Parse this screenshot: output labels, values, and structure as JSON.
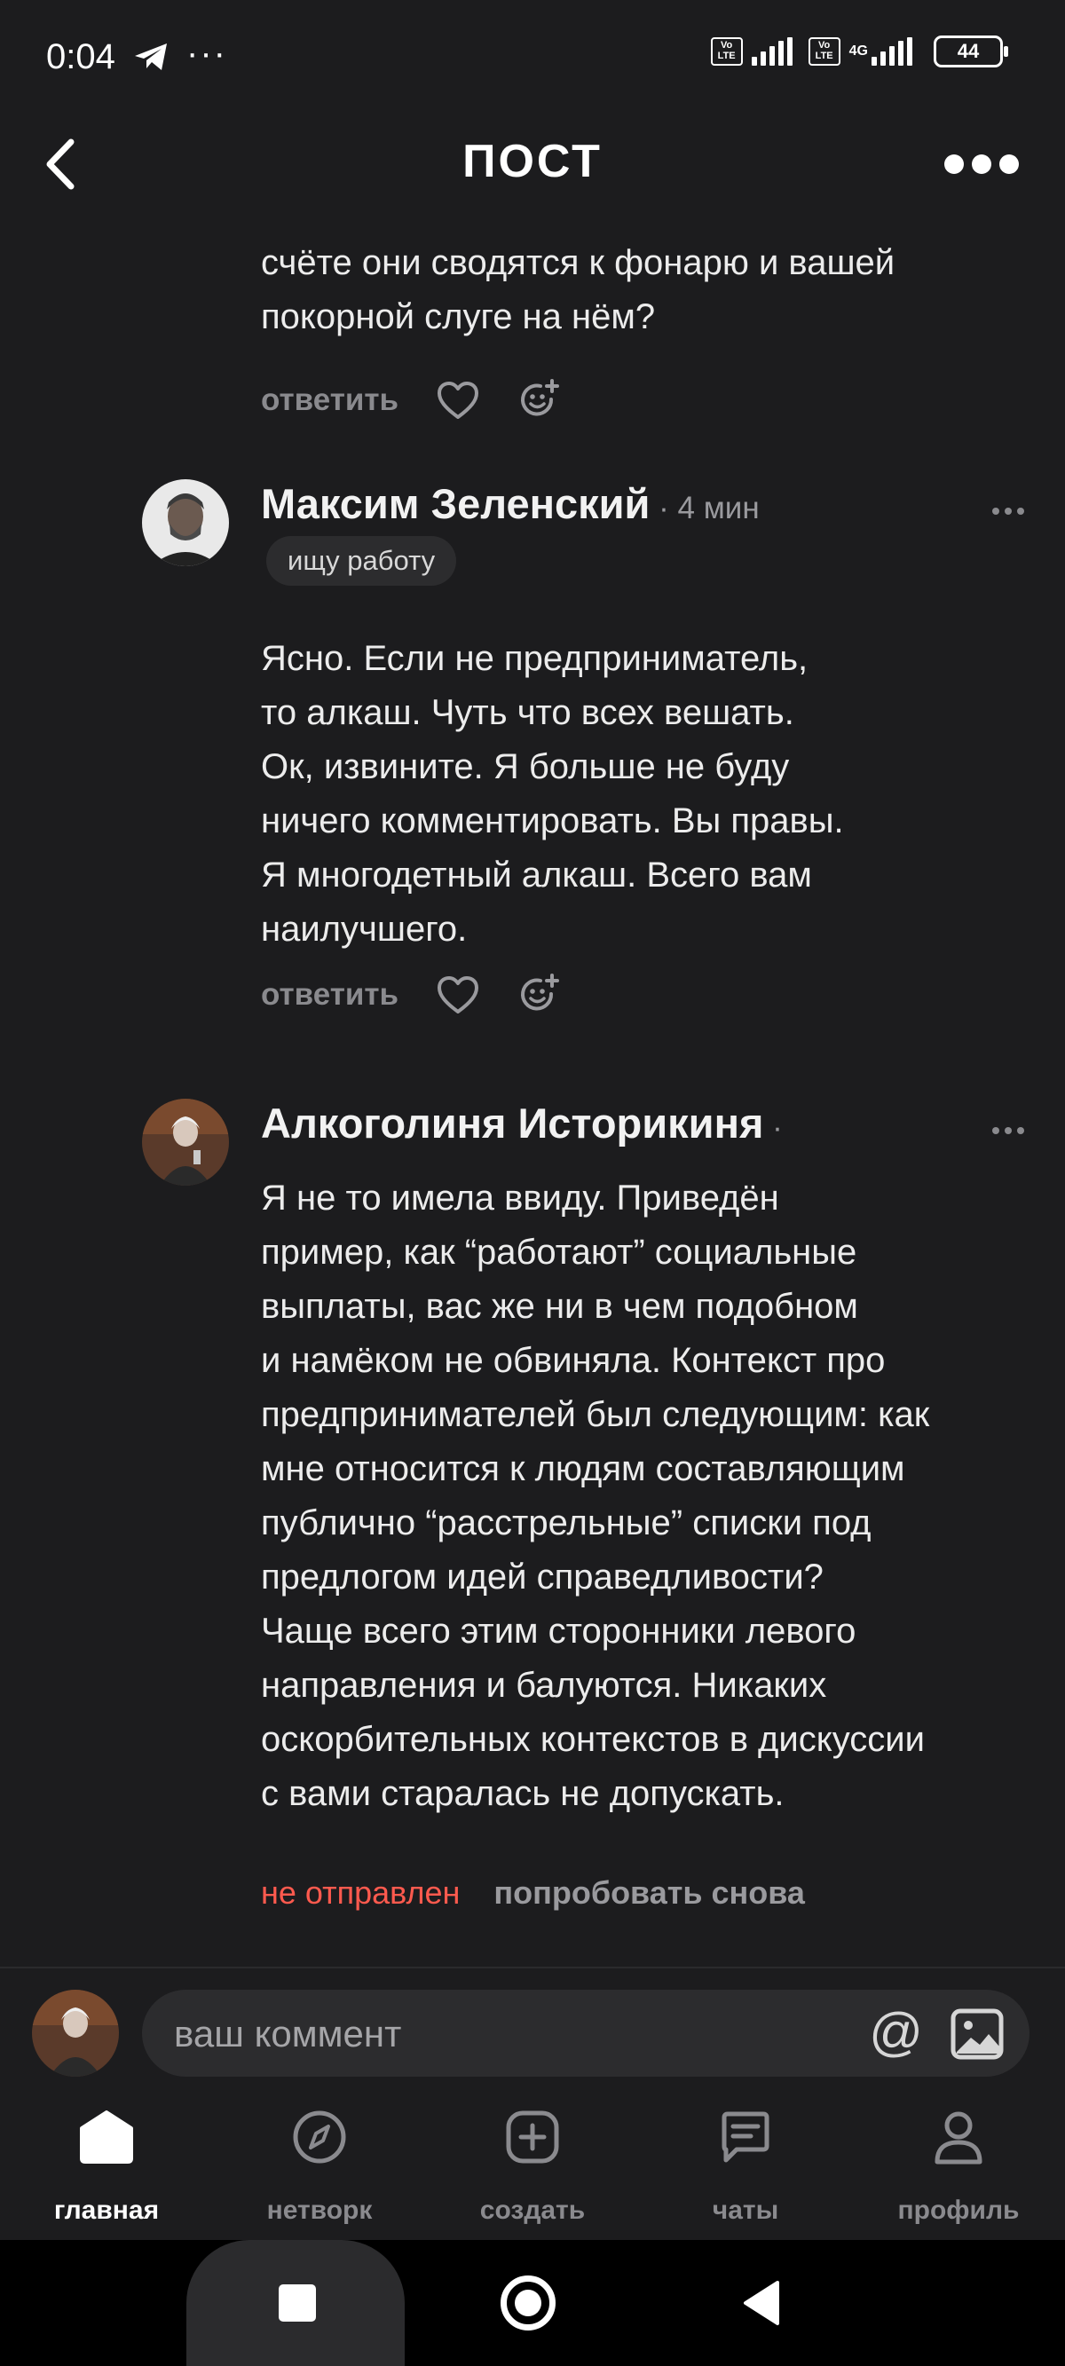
{
  "status_bar": {
    "time": "0:04",
    "dots": "···",
    "volte": "Vo LTE",
    "network": "4G",
    "battery": "44"
  },
  "header": {
    "title": "ПОСТ"
  },
  "feed": {
    "prev_comment": {
      "text_lines": [
        "счёте они сводятся к фонарю и вашей",
        "покорной слуге на нём?"
      ],
      "reply_label": "ответить"
    },
    "comments": [
      {
        "author": "Максим Зеленский",
        "time": " · 4 мин",
        "badge": "ищу работу",
        "text_lines": [
          "Ясно. Если не предприниматель,",
          "то алкаш. Чуть что всех вешать.",
          "Ок, извините. Я больше не буду",
          "ничего комментировать. Вы правы.",
          "Я многодетный алкаш. Всего вам",
          "наилучшего."
        ],
        "reply_label": "ответить"
      },
      {
        "author": "Алкоголиня Историкиня",
        "time": " ·",
        "text_lines": [
          "Я не то имела ввиду. Приведён",
          "пример, как “работают” социальные",
          "выплаты, вас же ни в чем подобном",
          "и намёком не обвиняла. Контекст про",
          "предпринимателей был следующим: как",
          "мне относится к людям составляющим",
          "публично “расстрельные” списки под",
          "предлогом идей справедливости?",
          "Чаще всего этим сторонники левого",
          "направления и балуются. Никаких",
          "оскорбительных контекстов в дискуссии",
          "с вами старалась не допускать."
        ],
        "status": "не отправлен",
        "retry": "попробовать снова"
      }
    ]
  },
  "comment_input": {
    "placeholder": "ваш коммент",
    "at_symbol": "@"
  },
  "bottom_nav": [
    {
      "label": "главная",
      "icon": "home-icon",
      "active": true
    },
    {
      "label": "нетворк",
      "icon": "compass-icon",
      "active": false
    },
    {
      "label": "создать",
      "icon": "plus-square-icon",
      "active": false
    },
    {
      "label": "чаты",
      "icon": "chat-icon",
      "active": false
    },
    {
      "label": "профиль",
      "icon": "profile-icon",
      "active": false
    }
  ],
  "colors": {
    "background": "#1c1c1e",
    "error": "#ff5a4e",
    "muted": "#8a8a8e"
  }
}
